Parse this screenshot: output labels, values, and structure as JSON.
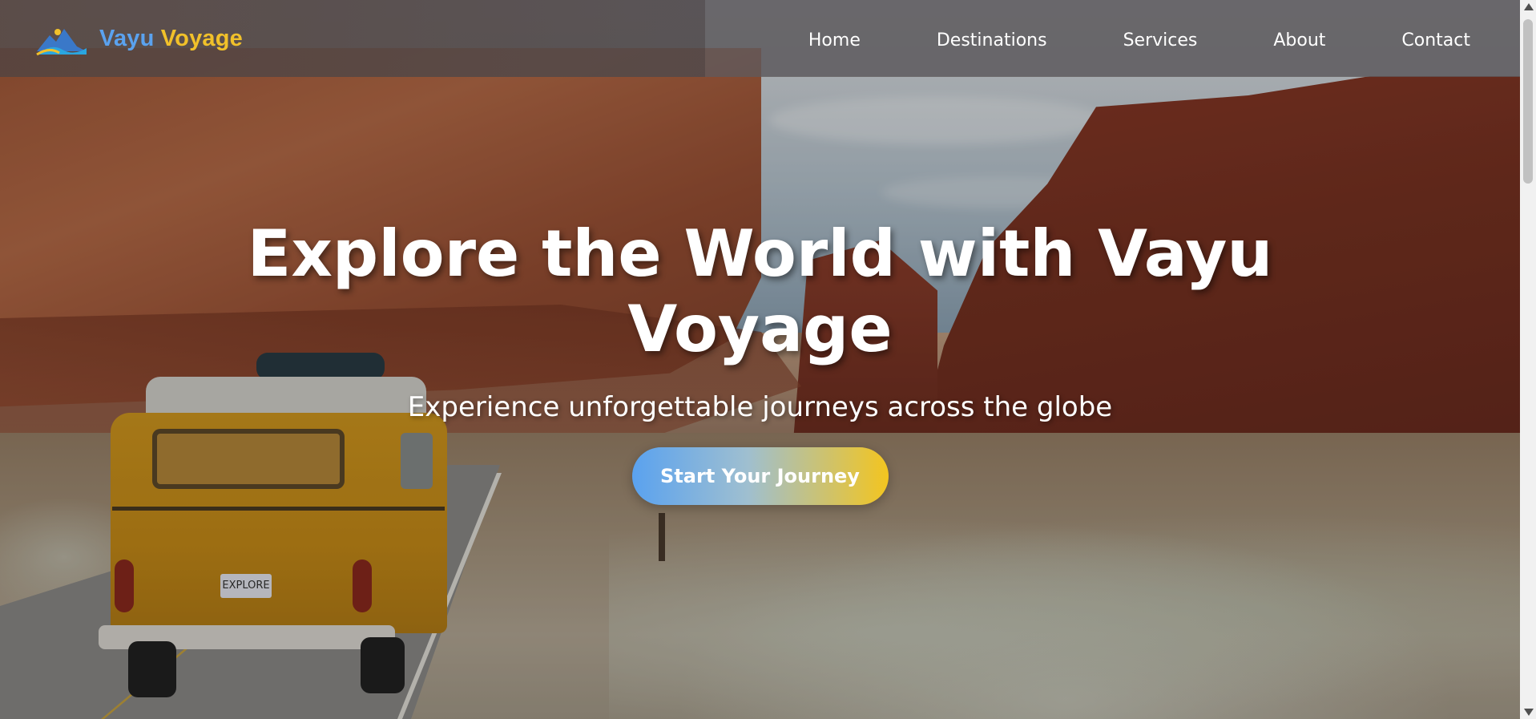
{
  "brand": {
    "first": "Vayu",
    "second": "Voyage",
    "logo_icon": "mountain-wave-icon",
    "colors": {
      "first": "#5aa2ef",
      "second": "#f1c12a"
    }
  },
  "nav": {
    "items": [
      {
        "label": "Home"
      },
      {
        "label": "Destinations"
      },
      {
        "label": "Services"
      },
      {
        "label": "About"
      },
      {
        "label": "Contact"
      }
    ]
  },
  "hero": {
    "title": "Explore the World with Vayu Voyage",
    "subtitle": "Experience unforgettable journeys across the globe",
    "cta_label": "Start Your Journey",
    "plate_text": "EXPLORE",
    "cta_gradient": [
      "#5aa2ef",
      "#f3c51f"
    ]
  }
}
